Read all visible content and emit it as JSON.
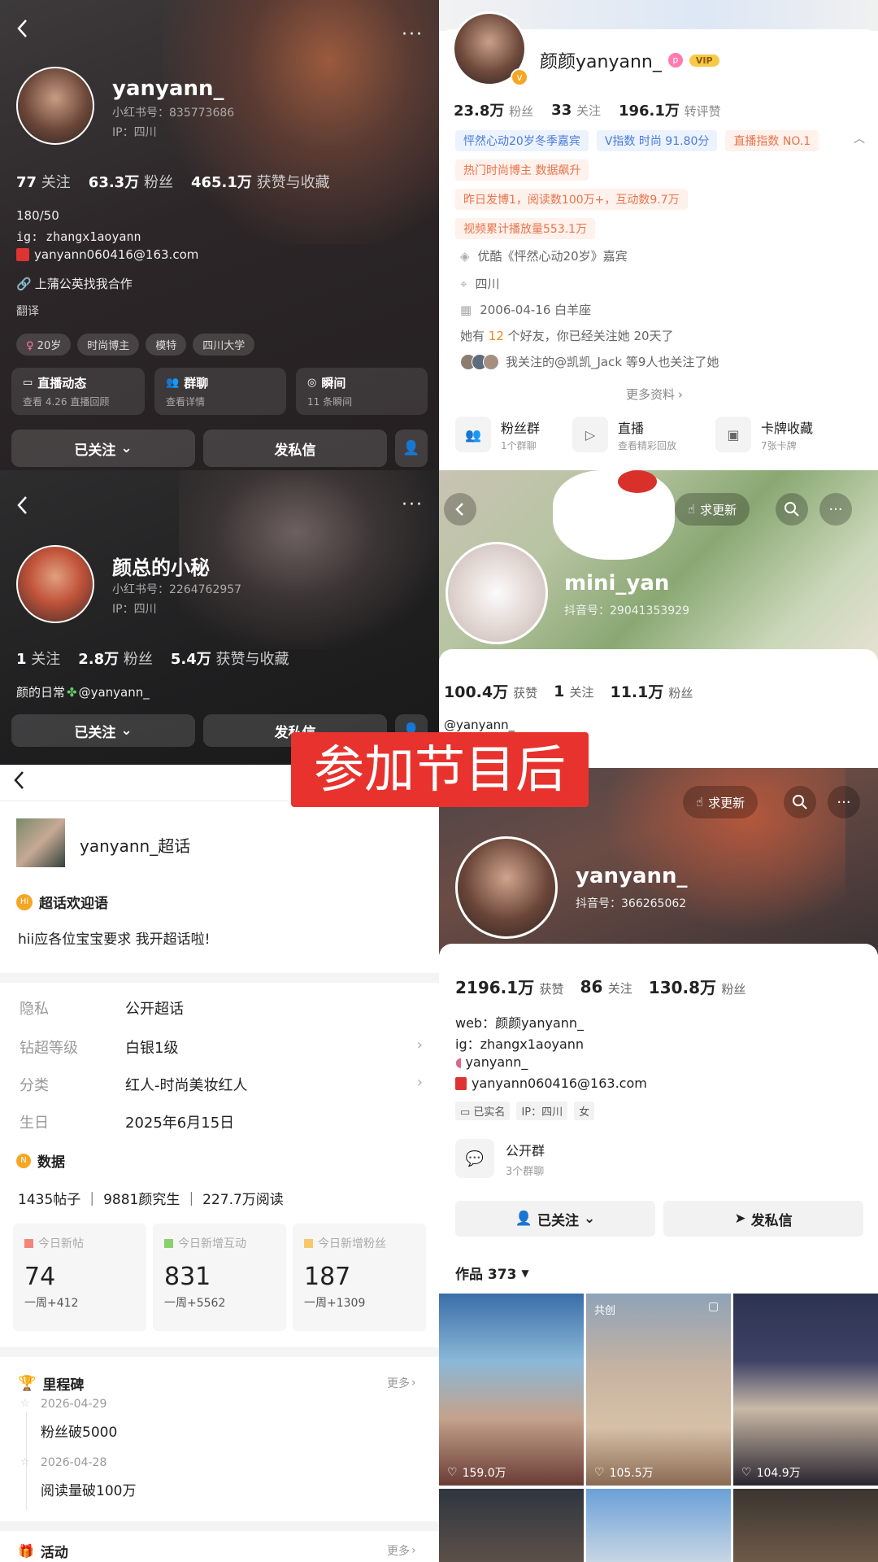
{
  "overlay_label": "参加节目后",
  "xhs1": {
    "username": "yanyann_",
    "id": "小红书号：835773686",
    "ip": "IP：四川",
    "stats": [
      {
        "num": "77",
        "label": "关注"
      },
      {
        "num": "63.3万",
        "label": "粉丝"
      },
      {
        "num": "465.1万",
        "label": "获赞与收藏"
      }
    ],
    "bio": [
      "180/50",
      "ig: zhangx1aoyann",
      "yanyann060416@163.com"
    ],
    "link": "上蒲公英找我合作",
    "translate": "翻译",
    "tags": [
      "20岁",
      "时尚博主",
      "模特",
      "四川大学"
    ],
    "quick": [
      {
        "title": "直播动态",
        "sub": "查看 4.26 直播回顾"
      },
      {
        "title": "群聊",
        "sub": "查看详情"
      },
      {
        "title": "瞬间",
        "sub": "11 条瞬间"
      }
    ],
    "follow_label": "已关注",
    "message_label": "发私信"
  },
  "xhs2": {
    "username": "颜总的小秘",
    "id": "小红书号：2264762957",
    "ip": "IP：四川",
    "stats": [
      {
        "num": "1",
        "label": "关注"
      },
      {
        "num": "2.8万",
        "label": "粉丝"
      },
      {
        "num": "5.4万",
        "label": "获赞与收藏"
      }
    ],
    "bio": "颜的日常",
    "bio_mention": "@yanyann_",
    "follow_label": "已关注",
    "message_label": "发私信"
  },
  "weibo": {
    "name": "颜颜yanyann_",
    "stats": [
      {
        "num": "23.8万",
        "label": "粉丝"
      },
      {
        "num": "33",
        "label": "关注"
      },
      {
        "num": "196.1万",
        "label": "转评赞"
      }
    ],
    "tags_row1": [
      "怦然心动20岁冬季嘉宾",
      "V指数 时尚 91.80分",
      "直播指数 NO.1"
    ],
    "tags_row2": [
      "热门时尚博主 数据飙升"
    ],
    "tags_row3": [
      "昨日发博1，阅读数100万+，互动数9.7万"
    ],
    "tags_row4": [
      "视频累计播放量553.1万"
    ],
    "info": [
      "优酷《怦然心动20岁》嘉宾",
      "四川",
      "2006-04-16 白羊座"
    ],
    "friends_pre": "她有",
    "friends_count": "12",
    "friends_post": "个好友，你已经关注她 20天了",
    "mutual": "我关注的@凯凯_Jack 等9人也关注了她",
    "more": "更多资料",
    "services": [
      {
        "title": "粉丝群",
        "sub": "1个群聊"
      },
      {
        "title": "直播",
        "sub": "查看精彩回放"
      },
      {
        "title": "卡牌收藏",
        "sub": "7张卡牌"
      }
    ]
  },
  "douyin1": {
    "request_update": "求更新",
    "name": "mini_yan",
    "id": "抖音号：29041353929",
    "stats": [
      {
        "num": "100.4万",
        "label": "获赞"
      },
      {
        "num": "1",
        "label": "关注"
      },
      {
        "num": "11.1万",
        "label": "粉丝"
      }
    ],
    "bio": "@yanyann_"
  },
  "supertopic": {
    "title": "yanyann_超话",
    "welcome_title": "超话欢迎语",
    "welcome_text": "hii应各位宝宝要求 我开超话啦!",
    "rows": [
      {
        "k": "隐私",
        "v": "公开超话"
      },
      {
        "k": "钻超等级",
        "v": "白银1级"
      },
      {
        "k": "分类",
        "v": "红人-时尚美妆红人"
      },
      {
        "k": "生日",
        "v": "2025年6月15日"
      }
    ],
    "data_title": "数据",
    "data_summary": "1435帖子 ｜ 9881颜究生 ｜ 227.7万阅读",
    "stats": [
      {
        "h": "今日新帖",
        "n": "74",
        "w": "一周+412",
        "color": "#f2857a"
      },
      {
        "h": "今日新增互动",
        "n": "831",
        "w": "一周+5562",
        "color": "#8ad06b"
      },
      {
        "h": "今日新增粉丝",
        "n": "187",
        "w": "一周+1309",
        "color": "#f5c96b"
      }
    ],
    "milestone_title": "里程碑",
    "more": "更多",
    "milestones": [
      {
        "date": "2026-04-29",
        "text": "粉丝破5000"
      },
      {
        "date": "2026-04-28",
        "text": "阅读量破100万"
      }
    ],
    "activity_title": "活动"
  },
  "douyin2": {
    "request_update": "求更新",
    "name": "yanyann_",
    "id": "抖音号：366265062",
    "stats": [
      {
        "num": "2196.1万",
        "label": "获赞"
      },
      {
        "num": "86",
        "label": "关注"
      },
      {
        "num": "130.8万",
        "label": "粉丝"
      }
    ],
    "bio": [
      "web：颜颜yanyann_",
      "ig：zhangx1aoyann",
      "yanyann_",
      "yanyann060416@163.com"
    ],
    "badges": [
      "已实名",
      "IP：四川",
      "女"
    ],
    "group_title": "公开群",
    "group_sub": "3个群聊",
    "follow_label": "已关注",
    "message_label": "发私信",
    "works_label": "作品 373",
    "co_label": "共创",
    "likes": [
      "159.0万",
      "105.5万",
      "104.9万"
    ]
  }
}
